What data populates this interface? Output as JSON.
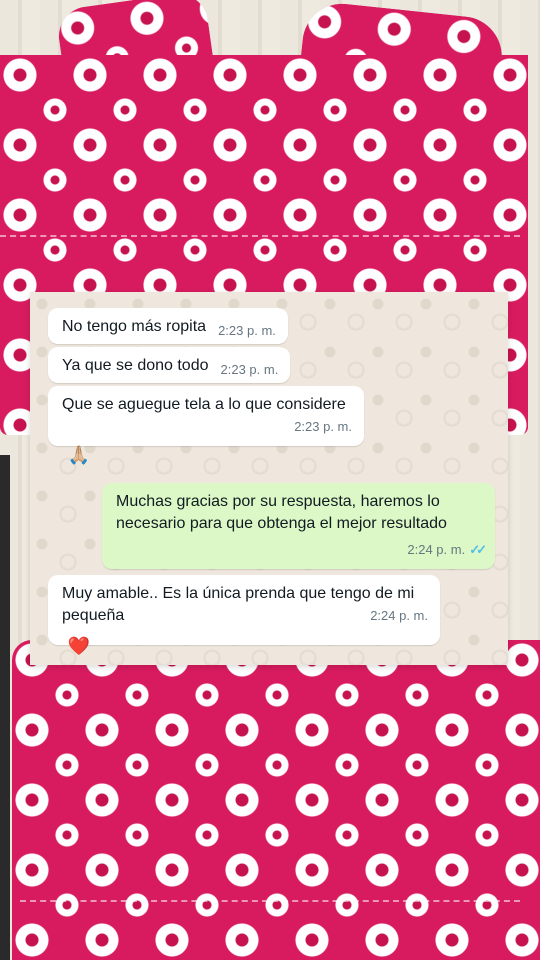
{
  "messages": [
    {
      "id": "m1",
      "direction": "in",
      "text": "No tengo más ropita",
      "time": "2:23 p. m."
    },
    {
      "id": "m2",
      "direction": "in",
      "text": "Ya que se dono todo",
      "time": "2:23 p. m."
    },
    {
      "id": "m3",
      "direction": "in",
      "text": "Que se aguegue tela a lo que considere",
      "time": "2:23 p. m."
    },
    {
      "id": "m4",
      "direction": "in",
      "emoji": "🙏🏼"
    },
    {
      "id": "m5",
      "direction": "out",
      "text": "Muchas gracias por su respuesta, haremos lo necesario para que obtenga el mejor resultado",
      "time": "2:24 p. m.",
      "status": "read"
    },
    {
      "id": "m6",
      "direction": "in",
      "text": "Muy amable.. Es la única prenda que tengo de mi pequeña",
      "time": "2:24 p. m."
    },
    {
      "id": "m7",
      "direction": "in",
      "emoji": "❤️"
    }
  ],
  "colors": {
    "incoming_bubble": "#ffffff",
    "outgoing_bubble": "#dcf8c6",
    "read_ticks": "#53bdeb",
    "fabric": "#d81b5f"
  },
  "icons": {
    "read_receipt": "double-check-icon"
  }
}
